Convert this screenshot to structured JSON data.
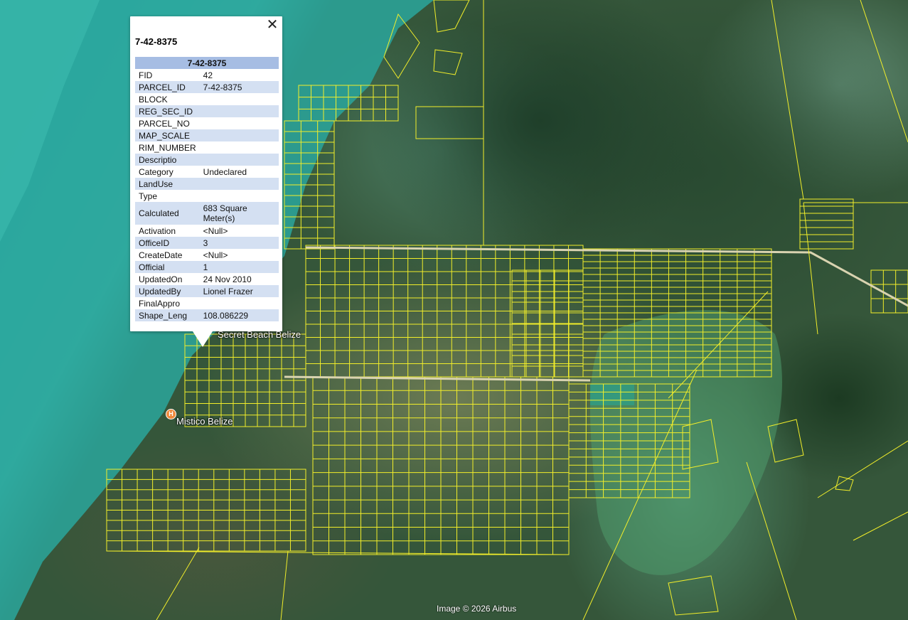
{
  "map": {
    "labels": {
      "secret_beach": "Secret Beach Belize",
      "mistico": "Mistico Belize"
    },
    "attribution": "Image © 2026 Airbus",
    "parcel_color": "#f2ee2a"
  },
  "popup": {
    "title": "7-42-8375",
    "table_header": "7-42-8375",
    "close_glyph": "✕",
    "rows": [
      {
        "key": "FID",
        "value": "42"
      },
      {
        "key": "PARCEL_ID",
        "value": "7-42-8375"
      },
      {
        "key": "BLOCK",
        "value": ""
      },
      {
        "key": "REG_SEC_ID",
        "value": ""
      },
      {
        "key": "PARCEL_NO",
        "value": ""
      },
      {
        "key": "MAP_SCALE",
        "value": ""
      },
      {
        "key": "RIM_NUMBER",
        "value": ""
      },
      {
        "key": "Descriptio",
        "value": ""
      },
      {
        "key": "Category",
        "value": "Undeclared"
      },
      {
        "key": "LandUse",
        "value": ""
      },
      {
        "key": "Type",
        "value": ""
      },
      {
        "key": "Calculated",
        "value": "683 Square Meter(s)"
      },
      {
        "key": "Activation",
        "value": "<Null>"
      },
      {
        "key": "OfficeID",
        "value": "3"
      },
      {
        "key": "CreateDate",
        "value": "<Null>"
      },
      {
        "key": "Official",
        "value": "1"
      },
      {
        "key": "UpdatedOn",
        "value": "24 Nov 2010"
      },
      {
        "key": "UpdatedBy",
        "value": "Lionel Frazer"
      },
      {
        "key": "FinalAppro",
        "value": ""
      },
      {
        "key": "Shape_Leng",
        "value": "108.086229"
      }
    ]
  }
}
